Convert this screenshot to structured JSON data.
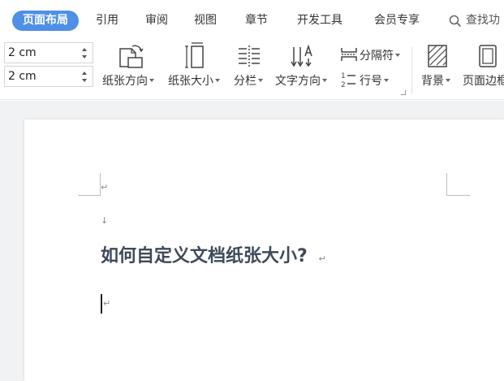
{
  "tabs": [
    {
      "label": "页面布局",
      "active": true
    },
    {
      "label": "引用"
    },
    {
      "label": "审阅"
    },
    {
      "label": "视图"
    },
    {
      "label": "章节"
    },
    {
      "label": "开发工具"
    },
    {
      "label": "会员专享"
    }
  ],
  "search": {
    "label": "查找功",
    "icon": "search-icon"
  },
  "ribbon": {
    "margin_top": "2 cm",
    "margin_bottom": "2 cm",
    "orientation_label": "纸张方向",
    "size_label": "纸张大小",
    "columns_label": "分栏",
    "text_direction_label": "文字方向",
    "separator_label": "分隔符",
    "line_number_label": "行号",
    "background_label": "背景",
    "page_border_label": "页面边框"
  },
  "document": {
    "heading": "如何自定义文档纸张大小?",
    "para_mark": "↵",
    "arrow_mark": "↓"
  },
  "colors": {
    "accent": "#4f8fe6",
    "heading": "#3e4a5a"
  }
}
